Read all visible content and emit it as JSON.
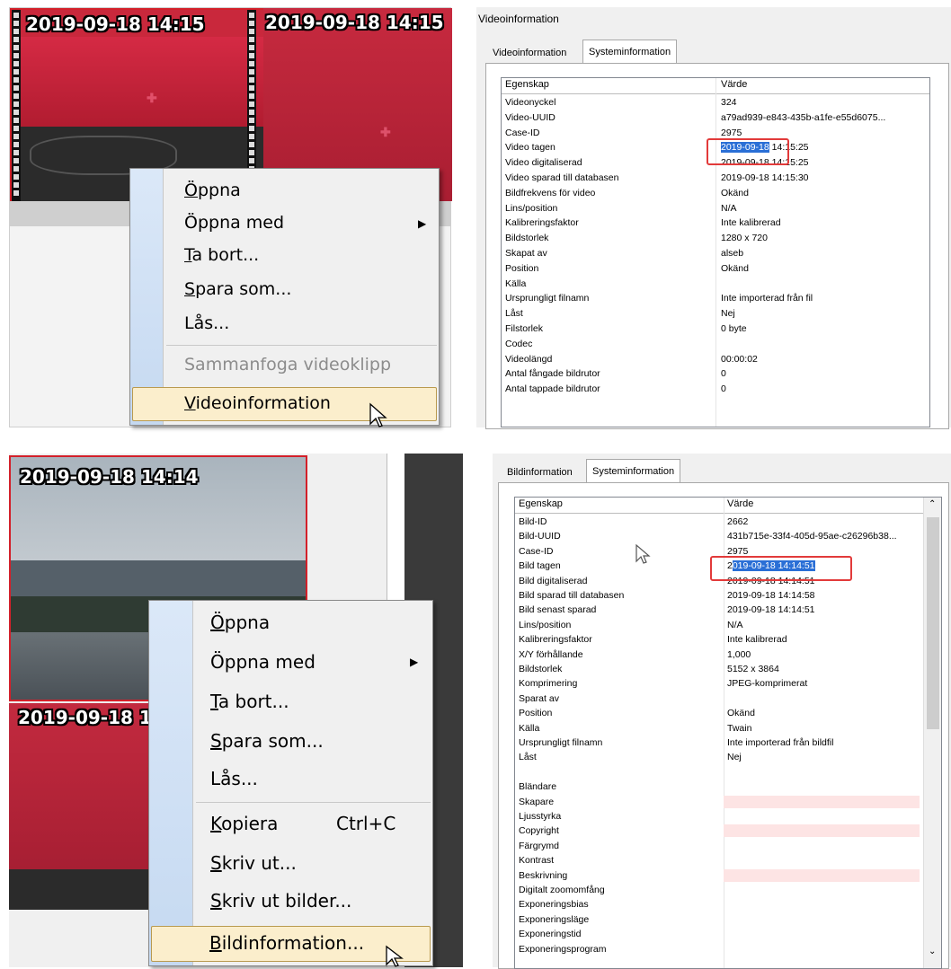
{
  "top_left": {
    "thumb1_timestamp": "2019-09-18 14:15",
    "thumb2_timestamp": "2019-09-18 14:15",
    "menu": {
      "items": [
        {
          "pre": "",
          "acc": "Ö",
          "post": "ppna"
        },
        {
          "pre": "",
          "acc": "",
          "post": "Öppna med"
        },
        {
          "pre": "",
          "acc": "T",
          "post": "a bort..."
        },
        {
          "pre": "",
          "acc": "S",
          "post": "para som..."
        },
        {
          "pre": "",
          "acc": "",
          "post": "Lås..."
        },
        {
          "pre": "",
          "acc": "",
          "post": "Sammanfoga videoklipp"
        },
        {
          "pre": "",
          "acc": "V",
          "post": "ideoinformation"
        }
      ]
    }
  },
  "top_right": {
    "dialog_title": "Videoinformation",
    "tabs": [
      "Videoinformation",
      "Systeminformation"
    ],
    "columns": [
      "Egenskap",
      "Värde"
    ],
    "rows": [
      [
        "Videonyckel",
        "324"
      ],
      [
        "Video-UUID",
        "a79ad939-e843-435b-a1fe-e55d6075..."
      ],
      [
        "Case-ID",
        "2975"
      ],
      [
        "Video tagen",
        "2019-09-18 14:15:25"
      ],
      [
        "Video digitaliserad",
        "2019-09-18 14:15:25"
      ],
      [
        "Video sparad till databasen",
        "2019-09-18 14:15:30"
      ],
      [
        "Bildfrekvens för video",
        "Okänd"
      ],
      [
        "Lins/position",
        "N/A"
      ],
      [
        "Kalibreringsfaktor",
        "Inte kalibrerad"
      ],
      [
        "Bildstorlek",
        "1280 x 720"
      ],
      [
        "Skapat av",
        "alseb"
      ],
      [
        "Position",
        "Okänd"
      ],
      [
        "Källa",
        ""
      ],
      [
        "Ursprungligt filnamn",
        "Inte importerad från fil"
      ],
      [
        "Låst",
        "Nej"
      ],
      [
        "Filstorlek",
        "0 byte"
      ],
      [
        "Codec",
        ""
      ],
      [
        "Videolängd",
        "00:00:02"
      ],
      [
        "Antal fångade bildrutor",
        "0"
      ],
      [
        "Antal tappade bildrutor",
        "0"
      ]
    ],
    "selected_part": "2019-09-18",
    "selected_rest": " 14:15:25"
  },
  "bottom_left": {
    "thumb1_timestamp": "2019-09-18 14:14",
    "thumb2_timestamp": "2019-09-18 1",
    "menu": {
      "items": [
        {
          "pre": "",
          "acc": "Ö",
          "post": "ppna"
        },
        {
          "pre": "",
          "acc": "",
          "post": "Öppna med"
        },
        {
          "pre": "",
          "acc": "T",
          "post": "a bort..."
        },
        {
          "pre": "",
          "acc": "S",
          "post": "para som..."
        },
        {
          "pre": "",
          "acc": "",
          "post": "Lås..."
        },
        {
          "pre": "",
          "acc": "K",
          "post": "opiera"
        },
        {
          "pre": "",
          "acc": "S",
          "post": "kriv ut..."
        },
        {
          "pre": "",
          "acc": "S",
          "post": "kriv ut bilder..."
        },
        {
          "pre": "",
          "acc": "B",
          "post": "ildinformation..."
        }
      ],
      "shortcut": "Ctrl+C"
    }
  },
  "bottom_right": {
    "tabs": [
      "Bildinformation",
      "Systeminformation"
    ],
    "columns": [
      "Egenskap",
      "Värde"
    ],
    "rows": [
      [
        "Bild-ID",
        "2662"
      ],
      [
        "Bild-UUID",
        "431b715e-33f4-405d-95ae-c26296b38..."
      ],
      [
        "Case-ID",
        "2975"
      ],
      [
        "Bild tagen",
        "2019-09-18 14:14:51"
      ],
      [
        "Bild digitaliserad",
        "2019-09-18 14:14:51"
      ],
      [
        "Bild sparad till databasen",
        "2019-09-18 14:14:58"
      ],
      [
        "Bild senast sparad",
        "2019-09-18 14:14:51"
      ],
      [
        "Lins/position",
        "N/A"
      ],
      [
        "Kalibreringsfaktor",
        "Inte kalibrerad"
      ],
      [
        "X/Y förhållande",
        "1,000"
      ],
      [
        "Bildstorlek",
        "5152 x 3864"
      ],
      [
        "Komprimering",
        "JPEG-komprimerat"
      ],
      [
        "Sparat av",
        ""
      ],
      [
        "Position",
        "Okänd"
      ],
      [
        "Källa",
        "Twain"
      ],
      [
        "Ursprungligt filnamn",
        "Inte importerad från bildfil"
      ],
      [
        "Låst",
        "Nej"
      ],
      [
        "",
        ""
      ],
      [
        "Bländare",
        ""
      ],
      [
        "Skapare",
        ""
      ],
      [
        "Ljusstyrka",
        ""
      ],
      [
        "Copyright",
        ""
      ],
      [
        "Färgrymd",
        ""
      ],
      [
        "Kontrast",
        ""
      ],
      [
        "Beskrivning",
        ""
      ],
      [
        "Digitalt zoomomfång",
        ""
      ],
      [
        "Exponeringsbias",
        ""
      ],
      [
        "Exponeringsläge",
        ""
      ],
      [
        "Exponeringstid",
        ""
      ],
      [
        "Exponeringsprogram",
        ""
      ]
    ],
    "pink_rows": [
      19,
      21,
      24
    ],
    "selected_part": "019-09-18 14:14:51",
    "selected_pre": "2"
  }
}
